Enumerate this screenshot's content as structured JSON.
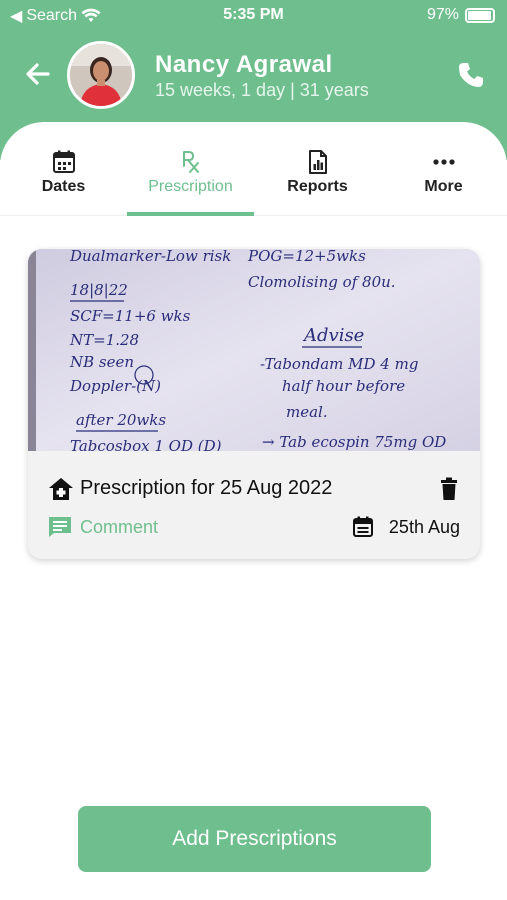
{
  "status_bar": {
    "carrier": "Search",
    "time": "5:35 PM",
    "battery": "97%",
    "battery_level": 0.97
  },
  "header": {
    "name": "Nancy Agrawal",
    "subtitle": "15 weeks, 1 day | 31 years"
  },
  "tabs": [
    {
      "label": "Dates",
      "icon": "calendar-icon",
      "active": false
    },
    {
      "label": "Prescription",
      "icon": "rx-icon",
      "active": true
    },
    {
      "label": "Reports",
      "icon": "report-icon",
      "active": false
    },
    {
      "label": "More",
      "icon": "more-dots-icon",
      "active": false
    }
  ],
  "prescription_card": {
    "image_text": {
      "line1": "Dualmarker-Low risk",
      "line2": "18|8|22",
      "line3": "SCF=11+6 wks",
      "line4": "NT=1.28",
      "line5": "NB seen",
      "line6": "Doppler-(N)",
      "line7": "after 20wks",
      "line8": "Tabcosbox 1 OD (D)",
      "right1": "POG=12+5wks",
      "right2": "Clomolising of 80u.",
      "right3": "Advise",
      "right4": "-Tabondam MD 4 mg",
      "right5": "half hour before",
      "right6": "meal.",
      "right7": "→ Tab ecospin 75mg OD"
    },
    "title": "Prescription for 25 Aug 2022",
    "comment_label": "Comment",
    "date": "25th Aug"
  },
  "add_button_label": "Add Prescriptions",
  "colors": {
    "accent": "#6fbf8e",
    "text": "#111111",
    "card_bg": "#f2f2f2"
  }
}
